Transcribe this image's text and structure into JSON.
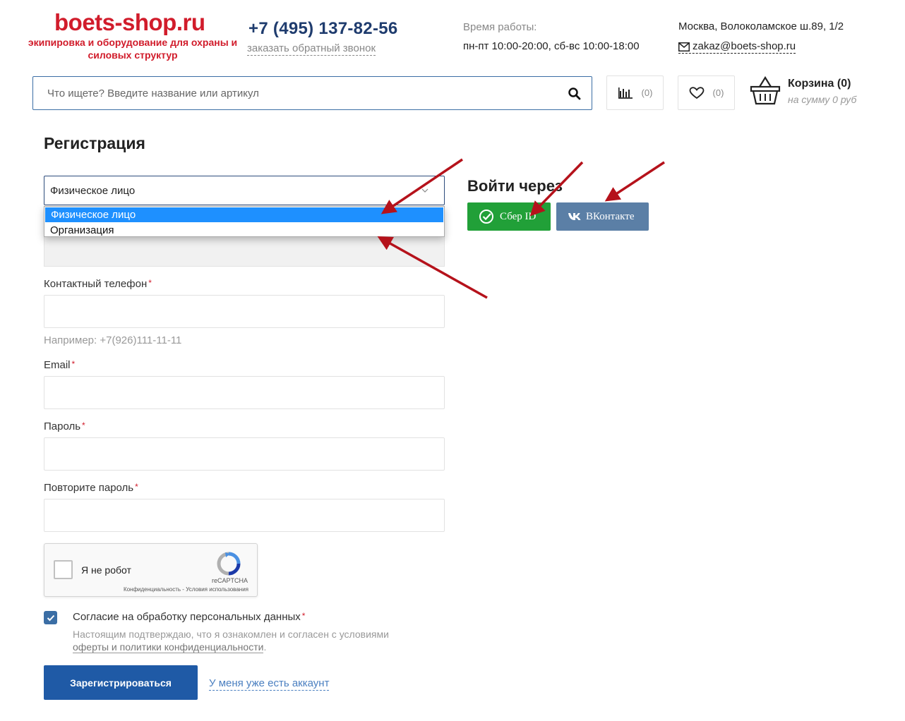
{
  "header": {
    "logo_title": "boets-shop.ru",
    "logo_subtitle": "экипировка и оборудование для охраны и силовых структур",
    "phone": "+7 (495) 137-82-56",
    "callback_link": "заказать обратный звонок",
    "hours_label": "Время работы:",
    "hours": "пн-пт 10:00-20:00, сб-вс 10:00-18:00",
    "address": "Москва, Волоколамское ш.89, 1/2",
    "email": "zakaz@boets-shop.ru"
  },
  "search": {
    "placeholder": "Что ищете? Введите название или артикул"
  },
  "compare": {
    "count": "(0)"
  },
  "favorites": {
    "count": "(0)"
  },
  "cart": {
    "title": "Корзина (0)",
    "sum": "на сумму 0 руб"
  },
  "form": {
    "title": "Регистрация",
    "type_select": {
      "value": "Физическое лицо",
      "options": [
        "Физическое лицо",
        "Организация"
      ]
    },
    "phone_label": "Контактный телефон",
    "phone_hint": "Например: +7(926)111-11-11",
    "email_label": "Email",
    "password_label": "Пароль",
    "password_repeat_label": "Повторите пароль",
    "required_mark": "*",
    "captcha": {
      "text": "Я не робот",
      "brand": "reCAPTCHA",
      "links": "Конфиденциальность - Условия использования"
    },
    "consent": {
      "title": "Согласие на обработку персональных данных",
      "text_before": "Настоящим подтверждаю, что я ознакомлен и согласен с условиями",
      "link": "оферты и политики конфиденциальности",
      "text_after": "."
    },
    "submit_label": "Зарегистрироваться",
    "have_account_link": "У меня уже есть аккаунт"
  },
  "social": {
    "title": "Войти через",
    "sber_label": "Сбер ID",
    "vk_label": "ВКонтакте"
  },
  "colors": {
    "brand_red": "#d11c2b",
    "brand_blue": "#1f5aa6",
    "sber_green": "#21a038",
    "vk_blue": "#5b7fa6",
    "annotation_arrow": "#b5121b"
  }
}
